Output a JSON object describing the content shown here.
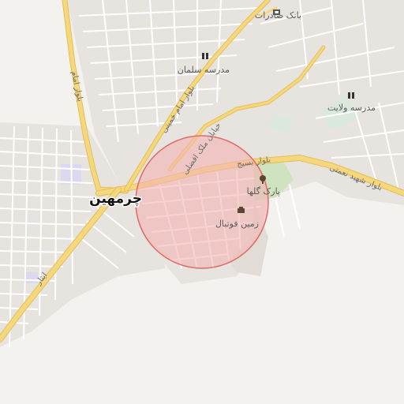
{
  "city": {
    "name": "چرمهین"
  },
  "pois": [
    {
      "id": "bank",
      "name": "بانک صادرات",
      "icon": "bank-icon"
    },
    {
      "id": "school-salman",
      "name": "مدرسه سلمان",
      "icon": "school-icon"
    },
    {
      "id": "school-velayat",
      "name": "مدرسه ولایت",
      "icon": "school-icon"
    },
    {
      "id": "park",
      "name": "پارک گلها",
      "icon": "tree-icon"
    },
    {
      "id": "football",
      "name": "زمین فوتبال",
      "icon": "stadium-icon"
    }
  ],
  "roads": [
    {
      "id": "basij",
      "name": "بلوار بسیج"
    },
    {
      "id": "nemati",
      "name": "بلوار شهید نعمتی"
    },
    {
      "id": "khomeini",
      "name": "بلوار امام خمینی"
    },
    {
      "id": "imam",
      "name": "بلوار امام"
    },
    {
      "id": "malek",
      "name": "خیابان ملک افضلی"
    },
    {
      "id": "isar",
      "name": "ایثار"
    }
  ],
  "colors": {
    "background": "#f4f2ef",
    "block": "#e6e3df",
    "street": "#ffffff",
    "main_road": "#f5d77e",
    "main_road_casing": "#e4bf56",
    "park": "#cfe3c0",
    "school": "#dbe8dd",
    "circle_fill": "#f3b4b4",
    "circle_stroke": "#e06a6a"
  },
  "highlight_circle": {
    "label": ""
  }
}
